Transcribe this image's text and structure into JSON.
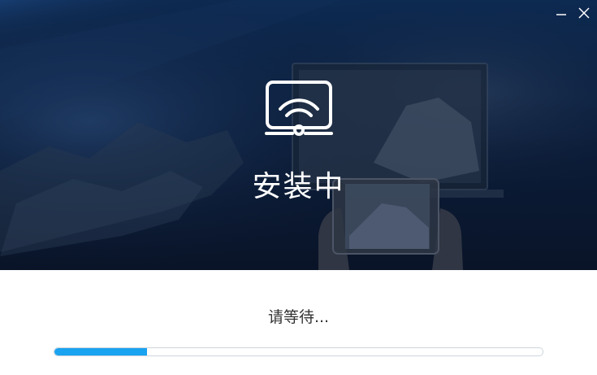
{
  "window": {
    "controls": {
      "minimize_icon": "minimize-icon",
      "close_icon": "close-icon"
    }
  },
  "hero": {
    "logo_icon": "screen-cast-wifi-icon",
    "title": "安装中"
  },
  "status": {
    "text": "请等待..."
  },
  "progress": {
    "percent": 19
  },
  "colors": {
    "accent": "#1aa3f0",
    "hero_bg": "#0b1c38",
    "title_text": "#ffffff",
    "status_text": "#333333"
  }
}
